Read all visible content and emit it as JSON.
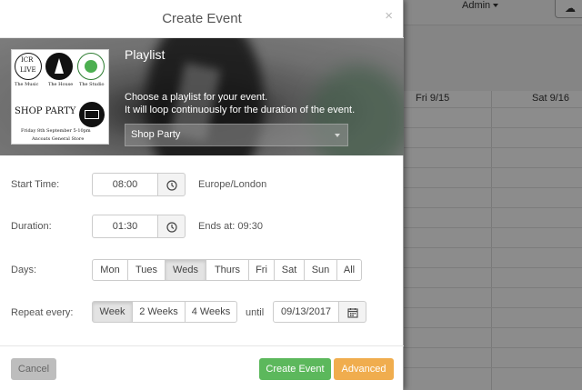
{
  "background": {
    "admin_label": "Admin",
    "calendar_columns": [
      "Fri 9/15",
      "Sat 9/16"
    ]
  },
  "modal": {
    "title": "Create Event",
    "close_glyph": "×"
  },
  "playlist": {
    "heading": "Playlist",
    "description_line1": "Choose a playlist for your event.",
    "description_line2": "It will loop continuously for the duration of the event.",
    "selected": "Shop Party",
    "poster": {
      "logo_top": "ICR",
      "logo_bottom": "LIVE",
      "captions": [
        "The Music",
        "The House",
        "The Studio"
      ],
      "title": "SHOP PARTY",
      "date_line": "Friday 8th September 5-10pm",
      "venue_line": "Ancoats General Store"
    }
  },
  "start_time": {
    "label": "Start Time:",
    "value": "08:00",
    "timezone": "Europe/London"
  },
  "duration": {
    "label": "Duration:",
    "value": "01:30",
    "ends_at": "Ends at: 09:30"
  },
  "days": {
    "label": "Days:",
    "options": [
      "Mon",
      "Tues",
      "Weds",
      "Thurs",
      "Fri",
      "Sat",
      "Sun",
      "All"
    ],
    "selected": "Weds"
  },
  "repeat": {
    "label": "Repeat every:",
    "options": [
      "Week",
      "2 Weeks",
      "4 Weeks"
    ],
    "selected": "Week",
    "until_label": "until",
    "until_date": "09/13/2017"
  },
  "footer": {
    "cancel": "Cancel",
    "create": "Create Event",
    "advanced": "Advanced"
  },
  "colors": {
    "create": "#5cb85c",
    "advanced": "#f0ad4e",
    "cancel": "#bdbdbd"
  }
}
